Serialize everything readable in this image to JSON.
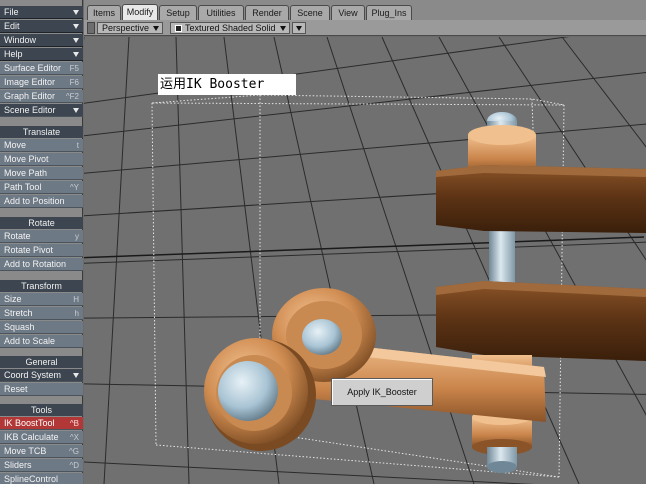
{
  "app": {
    "menus": [
      {
        "label": "File"
      },
      {
        "label": "Edit"
      },
      {
        "label": "Window"
      },
      {
        "label": "Help"
      }
    ],
    "editors": [
      {
        "label": "Surface Editor",
        "key": "F5"
      },
      {
        "label": "Image Editor",
        "key": "F6"
      },
      {
        "label": "Graph Editor",
        "key": "^F2"
      },
      {
        "label": "Scene Editor",
        "key": ""
      }
    ]
  },
  "toolbar": {
    "groups": [
      {
        "title": "Translate",
        "items": [
          {
            "label": "Move",
            "key": "t"
          },
          {
            "label": "Move Pivot",
            "key": ""
          },
          {
            "label": "Move Path",
            "key": ""
          },
          {
            "label": "Path Tool",
            "key": "^Y"
          },
          {
            "label": "Add to Position",
            "key": ""
          }
        ]
      },
      {
        "title": "Rotate",
        "items": [
          {
            "label": "Rotate",
            "key": "y"
          },
          {
            "label": "Rotate Pivot",
            "key": ""
          },
          {
            "label": "Add to Rotation",
            "key": ""
          }
        ]
      },
      {
        "title": "Transform",
        "items": [
          {
            "label": "Size",
            "key": "H"
          },
          {
            "label": "Stretch",
            "key": "h"
          },
          {
            "label": "Squash",
            "key": ""
          },
          {
            "label": "Add to Scale",
            "key": ""
          }
        ]
      },
      {
        "title": "General",
        "items": [
          {
            "label": "Coord System",
            "key": ""
          },
          {
            "label": "Reset",
            "key": ""
          }
        ]
      },
      {
        "title": "Tools",
        "items": [
          {
            "label": "IK BoostTool",
            "key": "^B"
          },
          {
            "label": "IKB Calculate",
            "key": "^X"
          },
          {
            "label": "Move TCB",
            "key": "^G"
          },
          {
            "label": "Sliders",
            "key": "^D"
          },
          {
            "label": "SplineControl",
            "key": ""
          }
        ]
      }
    ]
  },
  "tabs": [
    {
      "label": "Items"
    },
    {
      "label": "Modify",
      "active": true
    },
    {
      "label": "Setup"
    },
    {
      "label": "Utilities"
    },
    {
      "label": "Render"
    },
    {
      "label": "Scene"
    },
    {
      "label": "View"
    },
    {
      "label": "Plug_Ins"
    }
  ],
  "viewport": {
    "view_mode": "Perspective",
    "shading": "Textured Shaded Solid",
    "caption": "运用IK Booster",
    "apply_button": "Apply IK_Booster"
  },
  "colors": {
    "accent_active": "#b23838",
    "button_bg": "#6e7986",
    "header_bg": "#3c4550",
    "viewport_bg": "#707070",
    "grid_line": "#2b2b2b",
    "copper": "#d08d52",
    "wood": "#5a3214",
    "steel": "#a9c4d4"
  }
}
